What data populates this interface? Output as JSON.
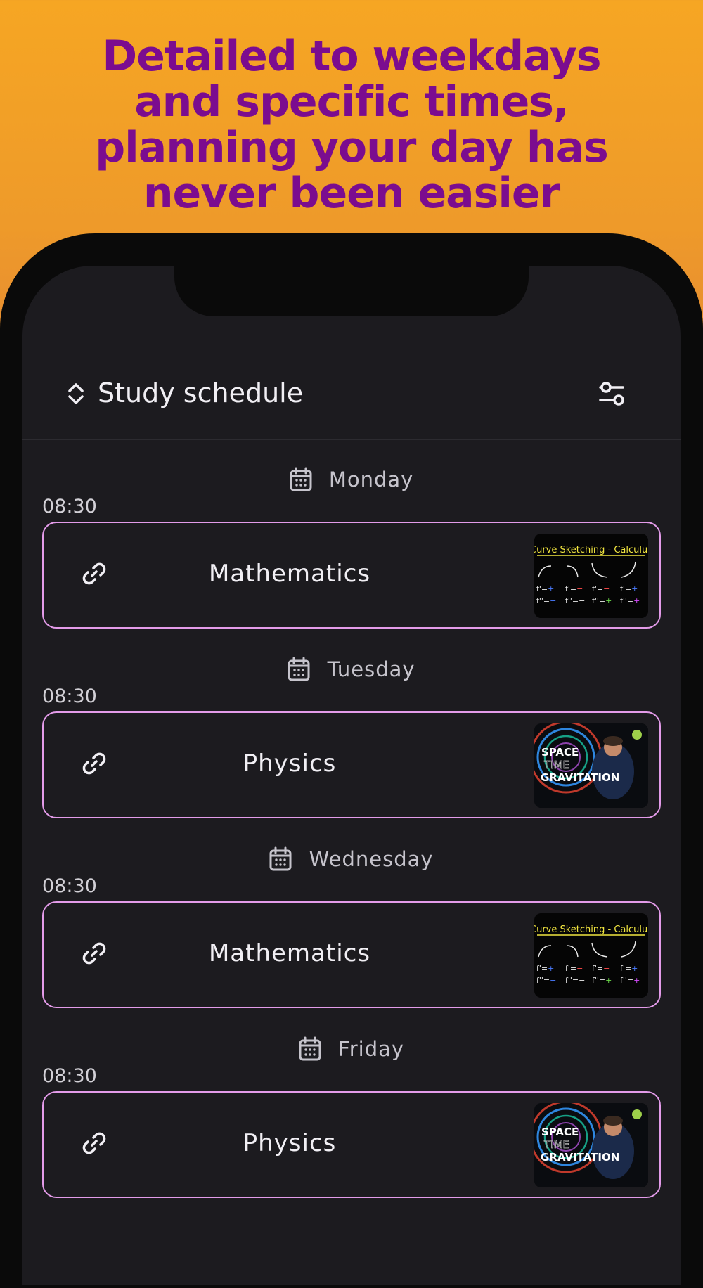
{
  "headline": {
    "lines": [
      "Detailed to weekdays",
      "and specific times,",
      "planning your day has",
      "never been easier"
    ]
  },
  "appbar": {
    "title": "Study schedule",
    "sort_icon": "unfold-chevrons-icon",
    "filter_icon": "sliders-icon"
  },
  "schedule": [
    {
      "day": "Monday",
      "time": "08:30",
      "subject": "Mathematics",
      "thumbnail_title": "Curve Sketching - Calculus"
    },
    {
      "day": "Tuesday",
      "time": "08:30",
      "subject": "Physics",
      "thumbnail_title": "SPACE TIME GRAVITATION"
    },
    {
      "day": "Wednesday",
      "time": "08:30",
      "subject": "Mathematics",
      "thumbnail_title": "Curve Sketching - Calculus"
    },
    {
      "day": "Friday",
      "time": "08:30",
      "subject": "Physics",
      "thumbnail_title": "SPACE TIME GRAVITATION"
    }
  ],
  "colors": {
    "headline": "#7b0c8f",
    "card_border": "#e39be9",
    "screen_bg": "#1c1b1f",
    "background_gradient_top": "#f6a623",
    "background_gradient_bottom": "#dc7c3a"
  }
}
